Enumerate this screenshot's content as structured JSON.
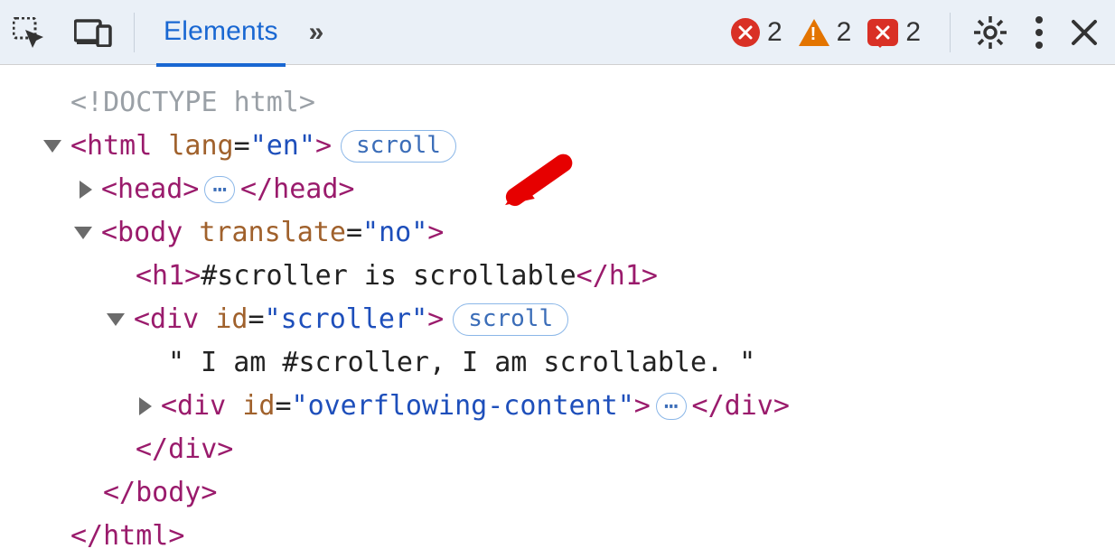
{
  "toolbar": {
    "active_tab": "Elements",
    "more_glyph": "»",
    "errors_count": "2",
    "warnings_count": "2",
    "issues_count": "2"
  },
  "dom": {
    "doctype": "<!DOCTYPE html>",
    "html_open": "<html ",
    "html_attr_name": "lang",
    "eq": "=",
    "q": "\"",
    "html_attr_val": "en",
    "close_gt": ">",
    "scroll_badge": "scroll",
    "head_open": "<head>",
    "head_close": "</head>",
    "ellipsis": "⋯",
    "body_open": "<body ",
    "body_attr_name": "translate",
    "body_attr_val": "no",
    "h1_open": "<h1>",
    "h1_text": "#scroller is scrollable",
    "h1_close": "</h1>",
    "div1_open": "<div ",
    "id_attr": "id",
    "div1_id_val": "scroller",
    "scroller_text": "\" I am #scroller, I am scrollable. \"",
    "div2_open": "<div ",
    "div2_id_val": "overflowing-content",
    "div_close": "</div>",
    "body_close": "</body>",
    "html_close": "</html>"
  }
}
